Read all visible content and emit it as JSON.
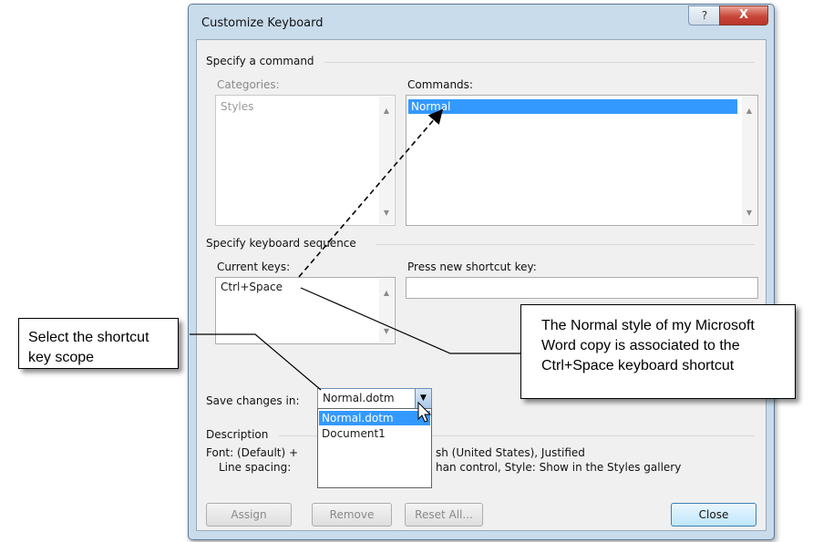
{
  "window": {
    "title": "Customize Keyboard",
    "help_glyph": "?",
    "close_glyph": "X"
  },
  "command_group": {
    "label": "Specify a command",
    "categories": {
      "label": "Categories:",
      "items": [
        "Styles"
      ]
    },
    "commands": {
      "label": "Commands:",
      "items": [
        "Normal"
      ],
      "selected": "Normal"
    }
  },
  "keyboard_group": {
    "label": "Specify keyboard sequence",
    "current_keys": {
      "label": "Current keys:",
      "items": [
        "Ctrl+Space"
      ]
    },
    "new_shortcut": {
      "label": "Press new shortcut key:",
      "value": ""
    }
  },
  "save_changes": {
    "label": "Save changes in:",
    "selected": "Normal.dotm",
    "options": [
      "Normal.dotm",
      "Document1"
    ]
  },
  "description": {
    "label": "Description",
    "line1_left": "Font: (Default) +",
    "line1_right": "sh (United States), Justified",
    "line2_left": "Line spacing:",
    "line2_right": "han control, Style: Show in the Styles gallery"
  },
  "buttons": {
    "assign": "Assign",
    "remove": "Remove",
    "reset_all": "Reset All...",
    "close": "Close"
  },
  "callouts": {
    "scope": [
      "Select the shortcut",
      "key scope"
    ],
    "normal_style": [
      "The Normal style of my Microsoft",
      "Word copy is associated to the",
      "Ctrl+Space keyboard shortcut"
    ]
  },
  "colors": {
    "selection": "#3399ff",
    "frame": "#c9dcec"
  }
}
